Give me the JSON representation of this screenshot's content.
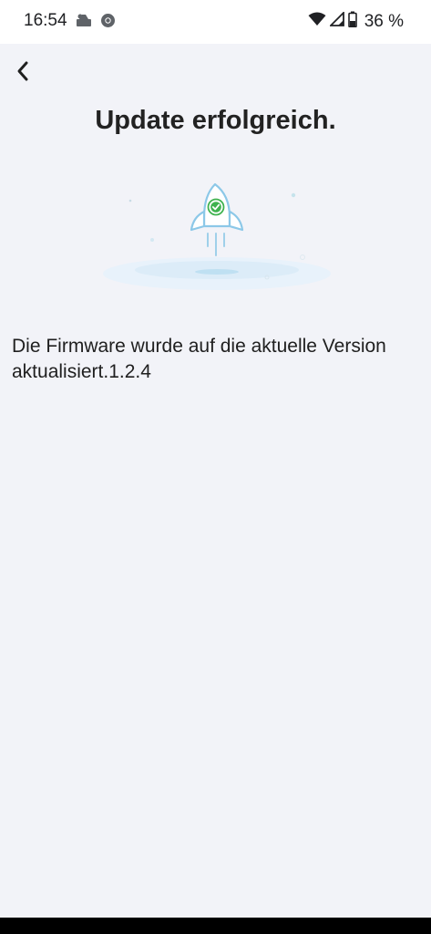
{
  "status_bar": {
    "time": "16:54",
    "battery": "36 %",
    "icons": [
      "notification-icon",
      "chrome-icon",
      "wifi-icon",
      "signal-icon",
      "battery-icon"
    ]
  },
  "header": {
    "back_icon": "chevron-left-icon",
    "title": "Update erfolgreich."
  },
  "illustration": {
    "icon": "rocket-check-icon",
    "accent_color": "#3fb24f"
  },
  "main": {
    "message": "Die Firmware wurde auf die aktuelle Version aktualisiert.1.2.4"
  },
  "colors": {
    "background": "#f2f3f8",
    "title": "#222222",
    "rocket_outline": "#8cc8e8"
  }
}
